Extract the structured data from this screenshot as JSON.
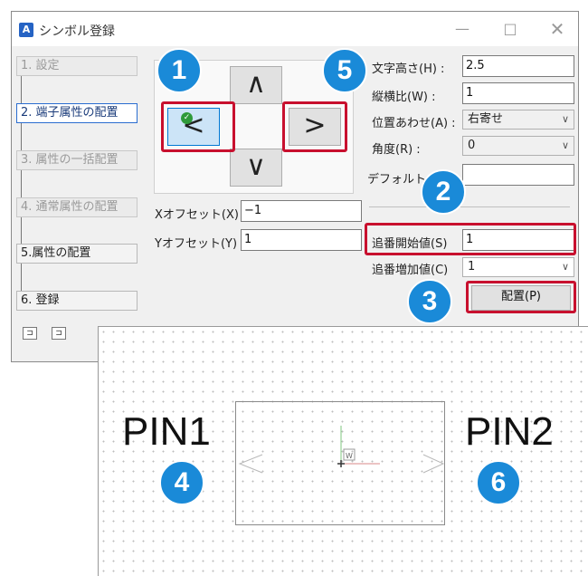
{
  "window": {
    "title": "シンボル登録",
    "minimize_icon": "minimize-icon",
    "maximize_icon": "maximize-icon",
    "close_icon": "close-icon"
  },
  "steps": [
    {
      "label": "1. 設定",
      "state": "disabled"
    },
    {
      "label": "2. 端子属性の配置",
      "state": "active"
    },
    {
      "label": "3. 属性の一括配置",
      "state": "disabled"
    },
    {
      "label": "4. 通常属性の配置",
      "state": "disabled"
    },
    {
      "label": "5.属性の配置",
      "state": "normal"
    },
    {
      "label": "6. 登録",
      "state": "normal"
    }
  ],
  "direction": {
    "up": "∧",
    "down": "∨",
    "left": "<",
    "right": ">"
  },
  "offsets": {
    "x_label": "Xオフセット(X) :",
    "x_value": "−1",
    "y_label": "Yオフセット(Y) :",
    "y_value": "1"
  },
  "text_props": {
    "height_label": "文字高さ(H) :",
    "height_value": "2.5",
    "aspect_label": "縦横比(W) :",
    "aspect_value": "1",
    "align_label": "位置あわせ(A) :",
    "align_value": "右寄せ",
    "angle_label": "角度(R) :",
    "angle_value": "0",
    "default_label": "デフォルト",
    "default_value": ""
  },
  "numbering": {
    "start_label": "追番開始値(S)",
    "start_value": "1",
    "increment_label": "追番増加値(C)",
    "increment_value": "1"
  },
  "place_button": "配置(P)",
  "badges": [
    "1",
    "2",
    "3",
    "4",
    "5",
    "6"
  ],
  "canvas": {
    "pin_left": "PIN1",
    "pin_right": "PIN2",
    "ucs_label": "W"
  },
  "colors": {
    "badge": "#1a8ad8",
    "highlight": "#c8102e",
    "active_step": "#2a6dd0"
  }
}
